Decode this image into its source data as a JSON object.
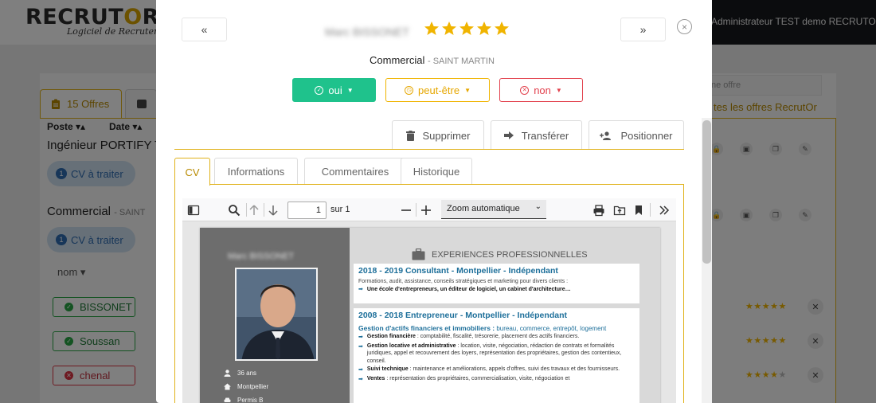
{
  "app": {
    "logo_main_pre": "RECRUT",
    "logo_main_o": "O",
    "logo_main_post": "R",
    "logo_sub": "Logiciel de Recrutement",
    "user": "Administrateur TEST demo RECRUTOR"
  },
  "background": {
    "tab_offers": "15 Offres",
    "col_poste": "Poste ▾▴",
    "col_date": "Date ▾▴",
    "offers": [
      {
        "title": "Ingénieur PORTIFY TI",
        "location": "",
        "cv_count": "1",
        "cv_label": "CV à traiter"
      },
      {
        "title": "Commercial",
        "location": "- SAINT",
        "cv_count": "1",
        "cv_label": "CV à traiter"
      }
    ],
    "nom_header": "nom ▾",
    "candidates": [
      {
        "name": "BISSONET",
        "status": "ok",
        "stars": "★★★★★",
        "stars_empty": ""
      },
      {
        "name": "Soussan",
        "status": "ok",
        "stars": "★★★★★",
        "stars_empty": ""
      },
      {
        "name": "chenal",
        "status": "no",
        "stars": "★★★★",
        "stars_empty": "★"
      }
    ],
    "search_placeholder": "ne offre",
    "all_offers_link": "tes les offres RecrutOr"
  },
  "modal": {
    "prev_label": "«",
    "next_label": "»",
    "candidate_name": "Marc BISSONET",
    "rating": 5,
    "close_label": "×",
    "job_title": "Commercial",
    "job_location": "- SAINT MARTIN",
    "decisions": {
      "oui": "oui",
      "peut": "peut-être",
      "non": "non"
    },
    "actions": {
      "delete": "Supprimer",
      "transfer": "Transférer",
      "position": "Positionner"
    },
    "tabs": [
      "CV",
      "Informations",
      "Commentaires",
      "Historique"
    ],
    "active_tab": "CV"
  },
  "pdf": {
    "page_value": "1",
    "page_of": "sur 1",
    "zoom": "Zoom automatique",
    "cv": {
      "name": "Marc BISSONET",
      "age": "36 ans",
      "city": "Montpellier",
      "license": "Permis B",
      "section_title": "EXPERIENCES PROFESSIONNELLES",
      "exp1_title": "2018 - 2019    Consultant - Montpellier - Indépendant",
      "exp1_desc": "Formations, audit, assistance, conseils stratégiques et marketing pour divers clients :",
      "exp1_bullet": "Une école d'entrepreneurs, un éditeur de logiciel, un cabinet d'architecture…",
      "exp2_title": "2008 - 2018    Entrepreneur - Montpellier - Indépendant",
      "exp2_sub": "Gestion d'actifs financiers et immobiliers :",
      "exp2_sub_detail": " bureau, commerce, entrepôt, logement",
      "exp2_items": [
        {
          "bold": "Gestion financière",
          "text": " : comptabilité, fiscalité, trésorerie, placement des actifs financiers."
        },
        {
          "bold": "Gestion locative et administrative",
          "text": " : location, visite, négociation, rédaction de contrats et formalités juridiques, appel et recouvrement des loyers, représentation des propriétaires, gestion des contentieux, conseil."
        },
        {
          "bold": "Suivi technique",
          "text": " : maintenance et améliorations, appels d'offres, suivi des travaux et des fournisseurs."
        },
        {
          "bold": "Ventes",
          "text": " : représentation des propriétaires, commercialisation, visite, négociation et"
        }
      ]
    }
  },
  "colors": {
    "accent": "#e0b21a",
    "oui": "#1fc28c",
    "peut": "#f0b400",
    "non": "#e2414d",
    "star": "#f0b400",
    "cv_blue": "#1d6f9a"
  }
}
